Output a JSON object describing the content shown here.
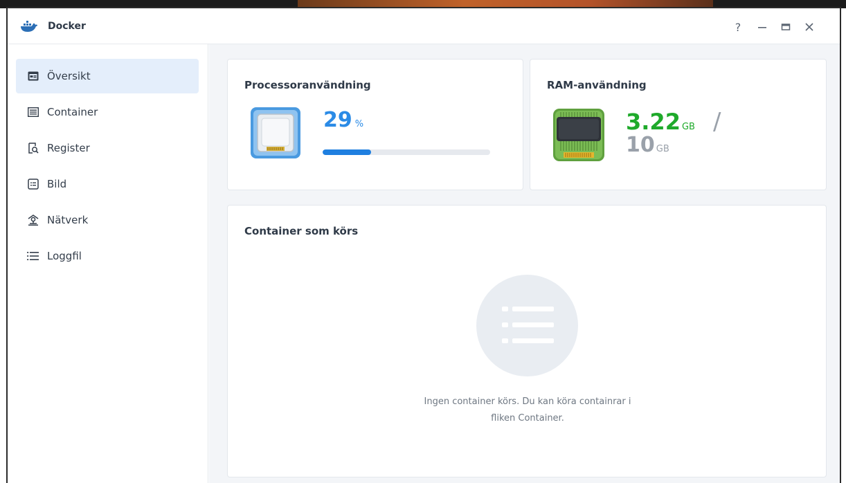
{
  "window": {
    "title": "Docker",
    "controls": {
      "help": "?",
      "minimize_icon": "minimize-icon",
      "maximize_icon": "maximize-icon",
      "close_icon": "close-icon"
    }
  },
  "sidebar": {
    "items": [
      {
        "label": "Översikt",
        "icon": "overview-icon",
        "active": true
      },
      {
        "label": "Container",
        "icon": "container-icon",
        "active": false
      },
      {
        "label": "Register",
        "icon": "registry-icon",
        "active": false
      },
      {
        "label": "Bild",
        "icon": "image-icon",
        "active": false
      },
      {
        "label": "Nätverk",
        "icon": "network-icon",
        "active": false
      },
      {
        "label": "Loggfil",
        "icon": "log-icon",
        "active": false
      }
    ]
  },
  "cpu": {
    "title": "Processoranvändning",
    "value": "29",
    "unit": "%",
    "progress_fraction": 0.29,
    "icon": "cpu-icon"
  },
  "ram": {
    "title": "RAM-användning",
    "used": "3.22",
    "used_unit": "GB",
    "separator": "/",
    "total": "10",
    "total_unit": "GB",
    "icon": "ram-icon"
  },
  "running": {
    "title": "Container som körs",
    "empty_line1": "Ingen container körs. Du kan köra containrar i",
    "empty_line2": "fliken Container.",
    "icon": "list-icon"
  },
  "colors": {
    "accent": "#2b8be6",
    "ram_green": "#1faa2b",
    "muted": "#9aa1aa",
    "active_bg": "#e4eefb"
  }
}
